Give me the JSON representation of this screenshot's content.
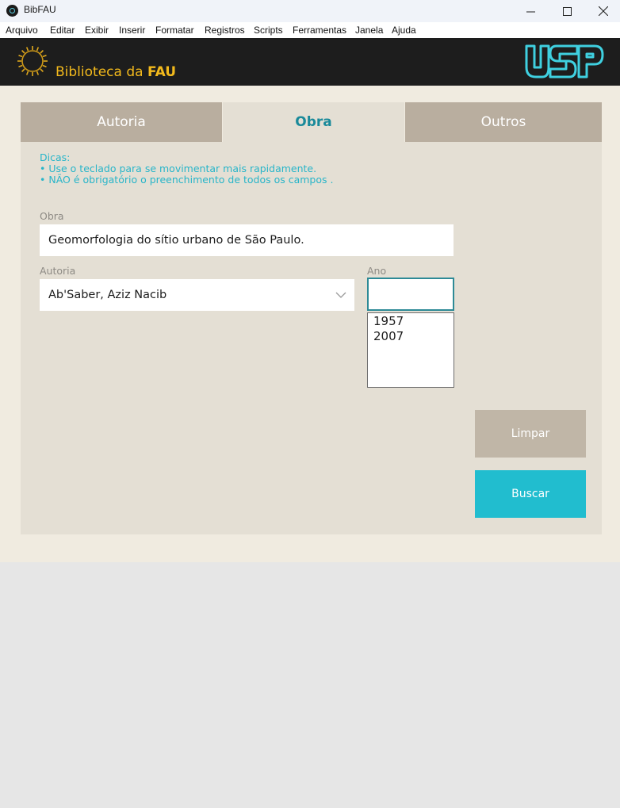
{
  "window": {
    "title": "BibFAU",
    "minimize": "—",
    "maximize": "☐",
    "close": "✕"
  },
  "menu": [
    "Arquivo",
    "Editar",
    "Exibir",
    "Inserir",
    "Formatar",
    "Registros",
    "Scripts",
    "Ferramentas",
    "Janela",
    "Ajuda"
  ],
  "header": {
    "title_prefix": "Biblioteca da ",
    "title_bold": "FAU",
    "logo_text": "USP"
  },
  "tabs": {
    "autoria": "Autoria",
    "obra": "Obra",
    "outros": "Outros",
    "active": "Obra"
  },
  "tips": {
    "title": "Dicas:",
    "line1": "• Use o teclado para se movimentar mais rapidamente.",
    "line2": "• NÃO é obrigatório o preenchimento de todos os campos ."
  },
  "form": {
    "obra_label": "Obra",
    "obra_value": "Geomorfologia do sítio urbano de São Paulo.",
    "autoria_label": "Autoria",
    "autoria_value": "Ab'Saber, Aziz Nacib",
    "ano_label": "Ano",
    "ano_value": "",
    "ano_options": [
      "1957",
      "2007"
    ]
  },
  "buttons": {
    "limpar": "Limpar",
    "buscar": "Buscar"
  },
  "colors": {
    "accent": "#21bdcf",
    "header_gold": "#f2b91c",
    "tab_inactive": "#b9ae9f",
    "panel": "#e4dfd4"
  }
}
